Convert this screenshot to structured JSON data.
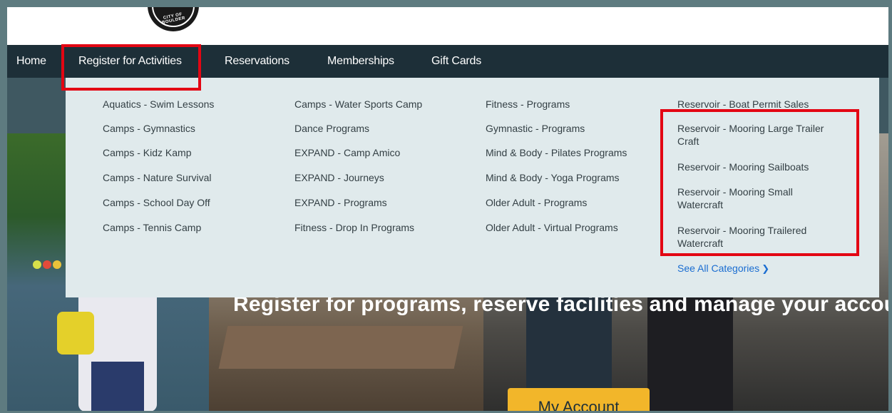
{
  "header": {
    "seal_text": "CITY OF BOULDER"
  },
  "nav": {
    "items": [
      {
        "label": "Home"
      },
      {
        "label": "Register for Activities"
      },
      {
        "label": "Reservations"
      },
      {
        "label": "Memberships"
      },
      {
        "label": "Gift Cards"
      }
    ]
  },
  "menu": {
    "columns": [
      [
        "Aquatics - Swim Lessons",
        "Camps - Gymnastics",
        "Camps - Kidz Kamp",
        "Camps - Nature Survival",
        "Camps - School Day Off",
        "Camps - Tennis Camp"
      ],
      [
        "Camps - Water Sports Camp",
        "Dance Programs",
        "EXPAND - Camp Amico",
        "EXPAND - Journeys",
        "EXPAND - Programs",
        "Fitness - Drop In Programs"
      ],
      [
        "Fitness - Programs",
        "Gymnastic - Programs",
        "Mind & Body - Pilates Programs",
        "Mind & Body - Yoga Programs",
        "Older Adult - Programs",
        "Older Adult - Virtual Programs"
      ],
      [
        "Reservoir - Boat Permit Sales",
        "Reservoir - Mooring Large Trailer Craft",
        "Reservoir - Mooring Sailboats",
        "Reservoir - Mooring Small Watercraft",
        "Reservoir - Mooring Trailered Watercraft"
      ]
    ],
    "see_all": "See All Categories"
  },
  "hero": {
    "text": "Register for programs, reserve facilities and manage your account h",
    "button": "My Account"
  },
  "colors": {
    "nav_bg": "#1d2f38",
    "menu_bg": "#e0eaec",
    "highlight": "#e30613",
    "link": "#1a6dd1",
    "button": "#f2b62a"
  }
}
